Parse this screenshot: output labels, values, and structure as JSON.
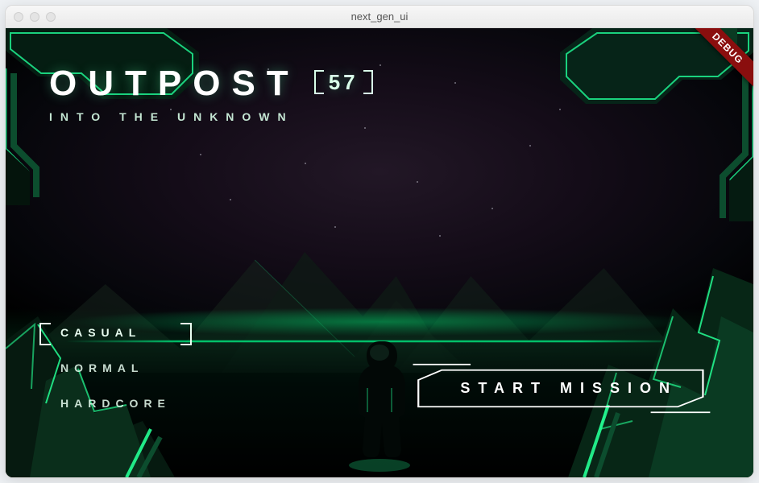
{
  "window": {
    "title": "next_gen_ui"
  },
  "debug_label": "DEBUG",
  "title": {
    "main": "OUTPOST",
    "badge": "57",
    "subtitle": "INTO THE UNKNOWN"
  },
  "difficulty": {
    "options": [
      "CASUAL",
      "NORMAL",
      "HARDCORE"
    ],
    "selected_index": 0
  },
  "start_button": {
    "label": "START MISSION"
  },
  "colors": {
    "neon": "#25ff95",
    "neon_dim": "#0c4d2e",
    "neon_glow": "rgba(37,255,149,0.55)",
    "ribbon": "#8a0e0e"
  }
}
